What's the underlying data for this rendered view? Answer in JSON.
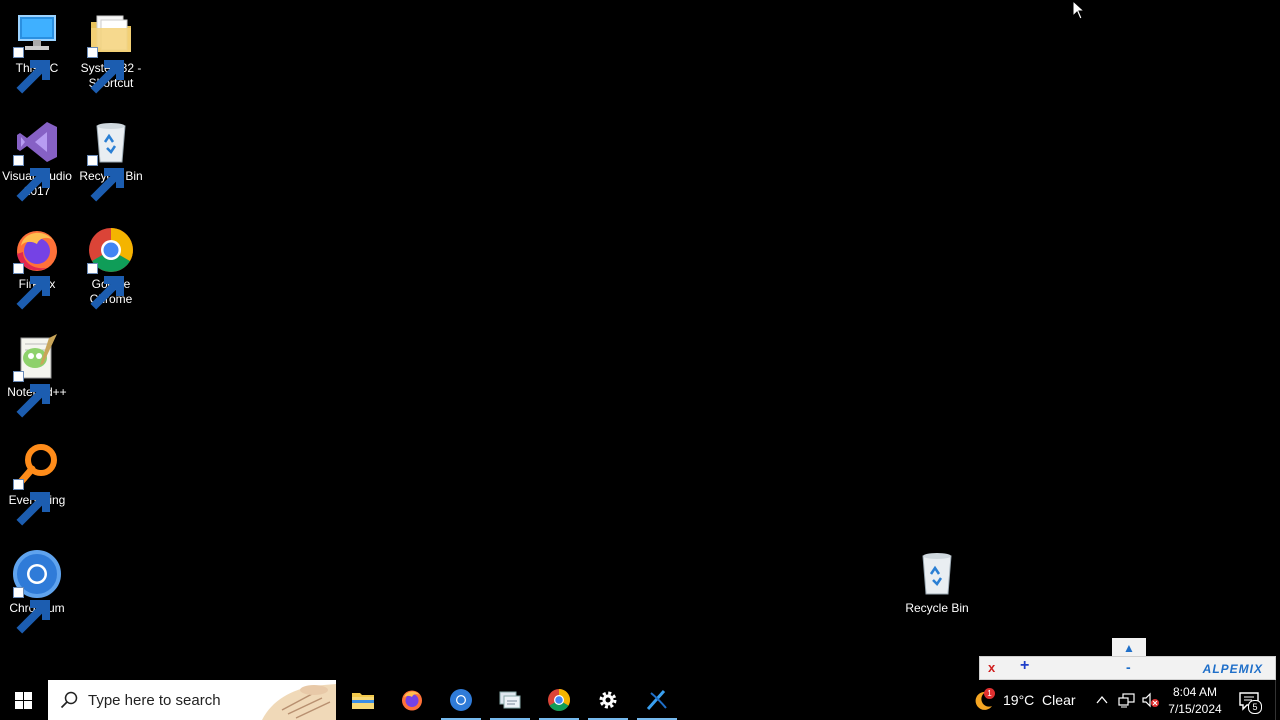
{
  "desktop": {
    "icons": [
      {
        "label": "This PC",
        "icon": "computer-icon"
      },
      {
        "label": "System32 -\nShortcut",
        "icon": "folder-icon"
      },
      {
        "label": "Visual Studio\n2017",
        "icon": "visual-studio-icon"
      },
      {
        "label": "Recycle Bin",
        "icon": "recycle-bin-icon"
      },
      {
        "label": "Firefox",
        "icon": "firefox-icon"
      },
      {
        "label": "Google\nChrome",
        "icon": "chrome-icon"
      },
      {
        "label": "Notepad++",
        "icon": "notepadpp-icon"
      },
      {
        "label": "Everything",
        "icon": "everything-icon"
      },
      {
        "label": "Chromium",
        "icon": "chromium-icon"
      },
      {
        "label": "Recycle Bin",
        "icon": "recycle-bin-icon"
      }
    ]
  },
  "alpemix": {
    "close": "x",
    "plus": "+",
    "minus": "-",
    "brand": "ALPEMIX",
    "expand": "▲"
  },
  "taskbar": {
    "search_placeholder": "Type here to search",
    "apps": [
      "file-explorer-icon",
      "firefox-icon",
      "chromium-icon",
      "network-window-icon",
      "chrome-icon",
      "settings-icon",
      "alpemix-icon"
    ],
    "weather_badge": "1",
    "weather": "19°C  Clear",
    "time": "8:04 AM",
    "date": "7/15/2024",
    "notifications": "5"
  },
  "colors": {
    "desktop_bg": "#000000",
    "taskbar_bg": "#000000",
    "active_indicator": "#76b9ed",
    "alpemix_brand": "#1f6fc9"
  }
}
